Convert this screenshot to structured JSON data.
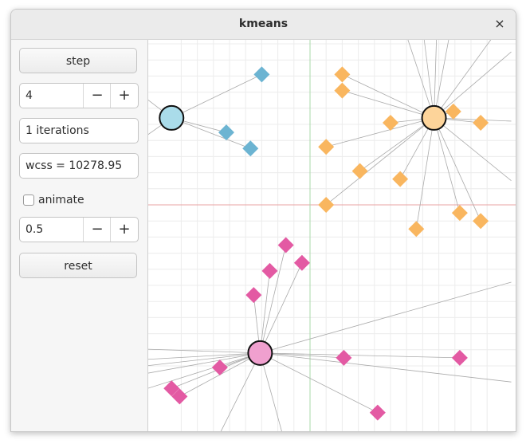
{
  "window": {
    "title": "kmeans",
    "close_glyph": "×"
  },
  "controls": {
    "step_label": "step",
    "k_value": "4",
    "minus_glyph": "−",
    "plus_glyph": "+",
    "iterations_text": "1 iterations",
    "wcss_text": "wcss = 10278.95",
    "animate_label": "animate",
    "animate_checked": false,
    "speed_value": "0.5",
    "reset_label": "reset"
  },
  "colors": {
    "cluster_blue": "#6cb4d2",
    "cluster_orange": "#f9b65f",
    "cluster_pink": "#e35aa3",
    "centroid_blue": "#aadcea",
    "centroid_orange": "#fdd49a",
    "centroid_pink": "#f0a0cf",
    "grid": "#ececec",
    "axis_x": "#e9a3a3",
    "axis_y": "#a9d8a9"
  },
  "chart_data": {
    "type": "scatter",
    "xlim": [
      -8.8,
      11.4
    ],
    "ylim": [
      10.4,
      -11.1
    ],
    "grid": true,
    "centroids": [
      {
        "cluster": "blue",
        "x": -8.6,
        "y": -5.4
      },
      {
        "cluster": "orange",
        "x": 7.7,
        "y": -5.4
      },
      {
        "cluster": "pink",
        "x": -3.1,
        "y": 9.2
      }
    ],
    "points": [
      {
        "cluster": "blue",
        "x": -3.0,
        "y": -8.1
      },
      {
        "cluster": "blue",
        "x": -5.2,
        "y": -4.5
      },
      {
        "cluster": "blue",
        "x": -3.7,
        "y": -3.5
      },
      {
        "cluster": "orange",
        "x": 2.0,
        "y": -8.1
      },
      {
        "cluster": "orange",
        "x": 2.0,
        "y": -7.1
      },
      {
        "cluster": "orange",
        "x": 5.0,
        "y": -5.1
      },
      {
        "cluster": "orange",
        "x": 1.0,
        "y": -3.6
      },
      {
        "cluster": "orange",
        "x": 3.1,
        "y": -2.1
      },
      {
        "cluster": "orange",
        "x": 5.6,
        "y": -1.6
      },
      {
        "cluster": "orange",
        "x": 1.0,
        "y": 0.0
      },
      {
        "cluster": "orange",
        "x": 8.9,
        "y": -5.8
      },
      {
        "cluster": "orange",
        "x": 10.6,
        "y": -5.1
      },
      {
        "cluster": "orange",
        "x": 9.3,
        "y": 0.5
      },
      {
        "cluster": "orange",
        "x": 10.6,
        "y": 1.0
      },
      {
        "cluster": "orange",
        "x": 6.6,
        "y": 1.5
      },
      {
        "cluster": "pink",
        "x": -1.5,
        "y": 2.5
      },
      {
        "cluster": "pink",
        "x": -2.5,
        "y": 4.1
      },
      {
        "cluster": "pink",
        "x": -0.5,
        "y": 3.6
      },
      {
        "cluster": "pink",
        "x": -3.5,
        "y": 5.6
      },
      {
        "cluster": "pink",
        "x": -5.6,
        "y": 10.1
      },
      {
        "cluster": "pink",
        "x": 2.1,
        "y": 9.5
      },
      {
        "cluster": "pink",
        "x": 9.3,
        "y": 9.5
      },
      {
        "cluster": "pink",
        "x": -8.6,
        "y": 11.4
      },
      {
        "cluster": "pink",
        "x": -8.1,
        "y": 11.9
      },
      {
        "cluster": "pink",
        "x": 4.2,
        "y": 12.9
      }
    ],
    "offscreen_links": [
      {
        "cluster": "orange",
        "x": 4.5,
        "y": -15.0
      },
      {
        "cluster": "orange",
        "x": 6.5,
        "y": -15.0
      },
      {
        "cluster": "orange",
        "x": 8.0,
        "y": -15.0
      },
      {
        "cluster": "orange",
        "x": 9.5,
        "y": -15.0
      },
      {
        "cluster": "orange",
        "x": 12.5,
        "y": -12.0
      },
      {
        "cluster": "orange",
        "x": 12.5,
        "y": -9.5
      },
      {
        "cluster": "orange",
        "x": 12.5,
        "y": -5.2
      },
      {
        "cluster": "orange",
        "x": 12.5,
        "y": -1.5
      },
      {
        "cluster": "blue",
        "x": -12.0,
        "y": -8.0
      },
      {
        "cluster": "blue",
        "x": -12.0,
        "y": -3.0
      },
      {
        "cluster": "pink",
        "x": -12.0,
        "y": 8.9
      },
      {
        "cluster": "pink",
        "x": -12.0,
        "y": 9.7
      },
      {
        "cluster": "pink",
        "x": -12.0,
        "y": 10.2
      },
      {
        "cluster": "pink",
        "x": -12.0,
        "y": 10.8
      },
      {
        "cluster": "pink",
        "x": -12.0,
        "y": 12.0
      },
      {
        "cluster": "pink",
        "x": -6.0,
        "y": 15.0
      },
      {
        "cluster": "pink",
        "x": -1.5,
        "y": 15.0
      },
      {
        "cluster": "pink",
        "x": 12.5,
        "y": 4.8
      },
      {
        "cluster": "pink",
        "x": 12.5,
        "y": 11.0
      }
    ]
  }
}
